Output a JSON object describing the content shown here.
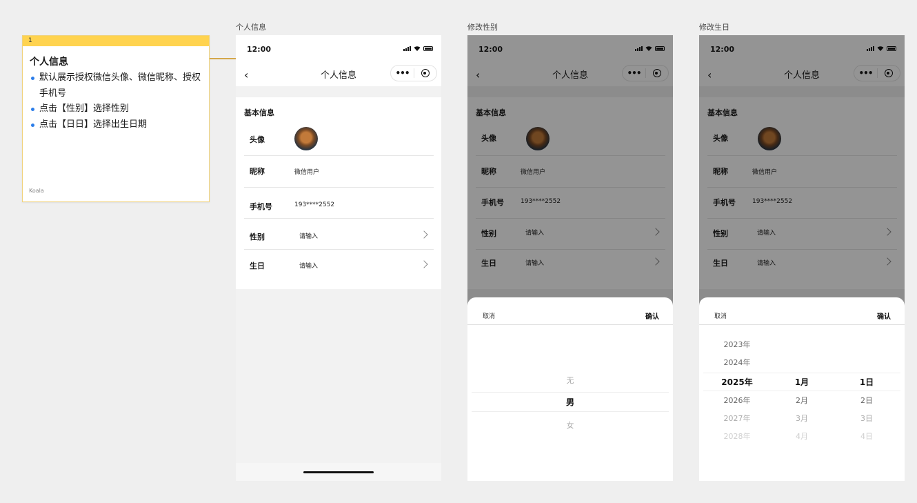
{
  "note": {
    "number": "1",
    "title": "个人信息",
    "items": [
      "默认展示授权微信头像、微信昵称、授权手机号",
      "点击【性别】选择性别",
      "点击【日日】选择出生日期"
    ],
    "author": "Koala"
  },
  "frames": [
    {
      "label": "个人信息"
    },
    {
      "label": "修改性别"
    },
    {
      "label": "修改生日"
    }
  ],
  "phone": {
    "time": "12:00",
    "nav_title": "个人信息",
    "back_icon": "chevron-left-icon",
    "more_icon": "more-dots-icon",
    "close_icon": "target-circle-icon",
    "section_title": "基本信息",
    "rows": {
      "avatar": {
        "label": "头像"
      },
      "nickname": {
        "label": "昵称",
        "value": "微信用户"
      },
      "phone": {
        "label": "手机号",
        "value": "193****2552"
      },
      "gender": {
        "label": "性别",
        "value": "请输入"
      },
      "birthday": {
        "label": "生日",
        "value": "请输入"
      }
    }
  },
  "sheet": {
    "cancel": "取消",
    "confirm": "确认"
  },
  "gender_picker": {
    "options": [
      "无",
      "男",
      "女"
    ],
    "selected": "男"
  },
  "date_picker": {
    "years": [
      "2023年",
      "2024年",
      "2025年",
      "2026年",
      "2027年",
      "2028年"
    ],
    "months": [
      "1月",
      "2月",
      "3月",
      "4月"
    ],
    "days": [
      "1日",
      "2日",
      "3日",
      "4日"
    ],
    "selected": {
      "year": "2025年",
      "month": "1月",
      "day": "1日"
    }
  },
  "colors": {
    "note_header": "#ffd34f",
    "connector": "#d4a74a",
    "bullet": "#2b7de9"
  }
}
